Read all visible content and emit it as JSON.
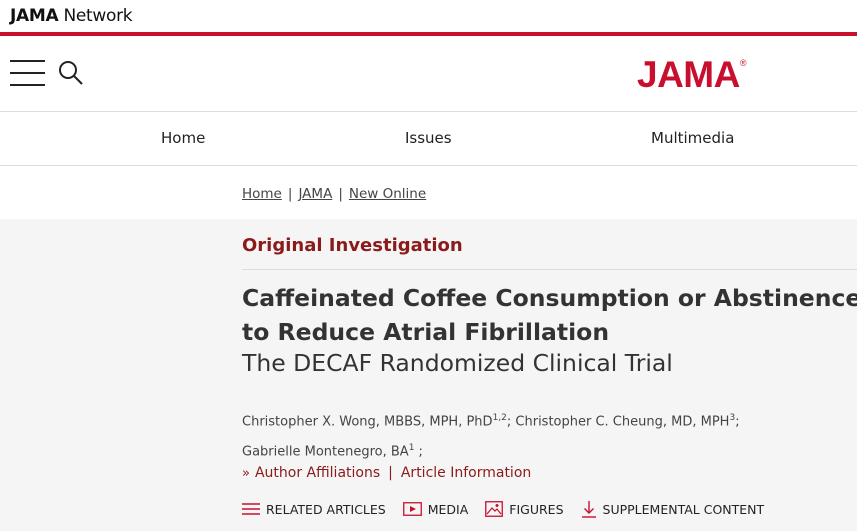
{
  "network": {
    "brand_bold": "JAMA",
    "brand_light": " Network"
  },
  "header": {
    "logo": "JAMA",
    "logo_mark": "®"
  },
  "nav": {
    "items": [
      "Home",
      "Issues",
      "Multimedia"
    ]
  },
  "breadcrumb": [
    "Home",
    "JAMA",
    "New Online"
  ],
  "article": {
    "type": "Original Investigation",
    "title": "Caffeinated Coffee Consumption or Abstinence to Reduce Atrial Fibrillation",
    "subtitle": "The DECAF Randomized Clinical Trial",
    "authors": [
      {
        "name": "Christopher X. Wong, MBBS, MPH, PhD",
        "sup": "1,2",
        "after": "; "
      },
      {
        "name": "Christopher C. Cheung, MD, MPH",
        "sup": "3",
        "after": ";"
      },
      {
        "name": "Gabrielle Montenegro, BA",
        "sup": "1",
        "after": " ;"
      }
    ],
    "links": {
      "affiliations": "Author Affiliations",
      "info": "Article Information",
      "separator": "|"
    }
  },
  "toolbar": {
    "related": "RELATED ARTICLES",
    "media": "MEDIA",
    "figures": "FIGURES",
    "supplemental": "SUPPLEMENTAL CONTENT"
  },
  "colors": {
    "brand_red": "#c8102e",
    "article_red": "#8b1a1a"
  }
}
